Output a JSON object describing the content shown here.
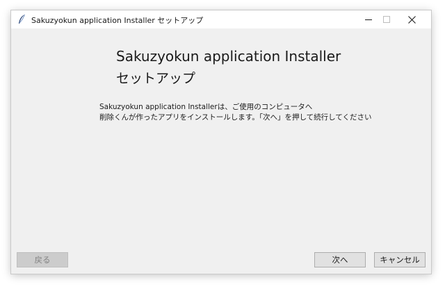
{
  "window": {
    "title": "Sakuzyokun application Installer セットアップ",
    "icon": "feather-icon",
    "controls": {
      "minimize_icon": "minimize-icon",
      "maximize_icon": "maximize-icon",
      "close_icon": "close-icon"
    }
  },
  "main": {
    "heading": "Sakuzyokun application Installer",
    "subheading": "セットアップ",
    "description_lines": [
      "Sakuzyokun application Installerは、ご使用のコンピュータへ",
      "削除くんが作ったアプリをインストールします。「次へ」を押して続行してください"
    ]
  },
  "footer": {
    "back_label": "戻る",
    "back_enabled": false,
    "next_label": "次へ",
    "cancel_label": "キャンセル"
  }
}
